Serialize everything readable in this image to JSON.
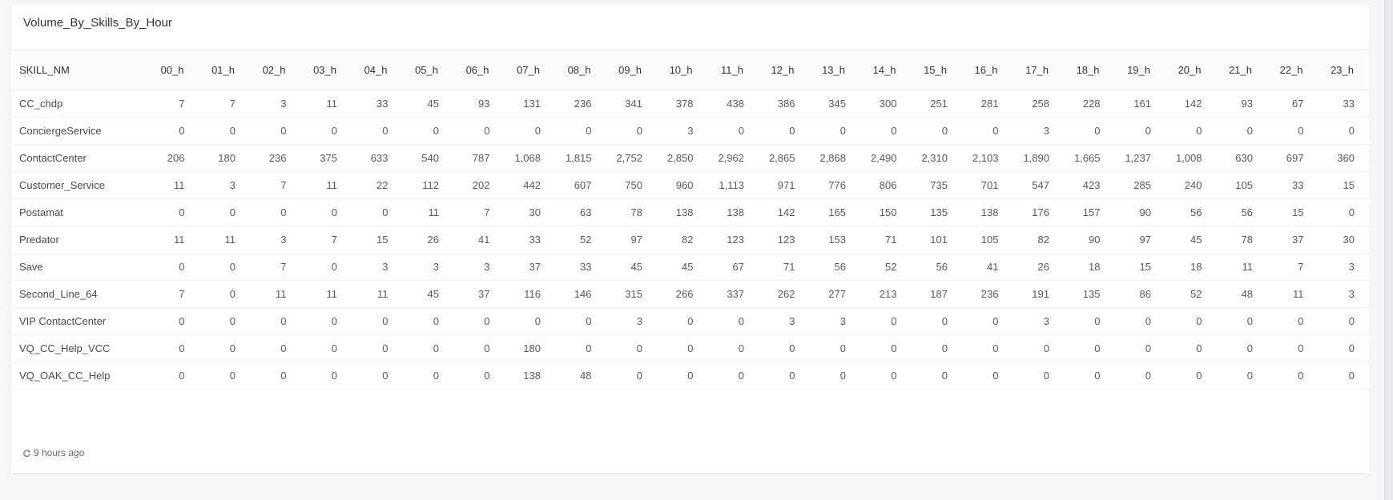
{
  "widget": {
    "title": "Volume_By_Skills_By_Hour",
    "refreshed": "9 hours ago"
  },
  "table": {
    "columns": [
      "SKILL_NM",
      "00_h",
      "01_h",
      "02_h",
      "03_h",
      "04_h",
      "05_h",
      "06_h",
      "07_h",
      "08_h",
      "09_h",
      "10_h",
      "11_h",
      "12_h",
      "13_h",
      "14_h",
      "15_h",
      "16_h",
      "17_h",
      "18_h",
      "19_h",
      "20_h",
      "21_h",
      "22_h",
      "23_h"
    ],
    "rows": [
      [
        "CC_chdp",
        "7",
        "7",
        "3",
        "11",
        "33",
        "45",
        "93",
        "131",
        "236",
        "341",
        "378",
        "438",
        "386",
        "345",
        "300",
        "251",
        "281",
        "258",
        "228",
        "161",
        "142",
        "93",
        "67",
        "33"
      ],
      [
        "ConciergeService",
        "0",
        "0",
        "0",
        "0",
        "0",
        "0",
        "0",
        "0",
        "0",
        "0",
        "3",
        "0",
        "0",
        "0",
        "0",
        "0",
        "0",
        "3",
        "0",
        "0",
        "0",
        "0",
        "0",
        "0"
      ],
      [
        "ContactCenter",
        "206",
        "180",
        "236",
        "375",
        "633",
        "540",
        "787",
        "1,068",
        "1,815",
        "2,752",
        "2,850",
        "2,962",
        "2,865",
        "2,868",
        "2,490",
        "2,310",
        "2,103",
        "1,890",
        "1,665",
        "1,237",
        "1,008",
        "630",
        "697",
        "360"
      ],
      [
        "Customer_Service",
        "11",
        "3",
        "7",
        "11",
        "22",
        "112",
        "202",
        "442",
        "607",
        "750",
        "960",
        "1,113",
        "971",
        "776",
        "806",
        "735",
        "701",
        "547",
        "423",
        "285",
        "240",
        "105",
        "33",
        "15"
      ],
      [
        "Postamat",
        "0",
        "0",
        "0",
        "0",
        "0",
        "11",
        "7",
        "30",
        "63",
        "78",
        "138",
        "138",
        "142",
        "165",
        "150",
        "135",
        "138",
        "176",
        "157",
        "90",
        "56",
        "56",
        "15",
        "0"
      ],
      [
        "Predator",
        "11",
        "11",
        "3",
        "7",
        "15",
        "26",
        "41",
        "33",
        "52",
        "97",
        "82",
        "123",
        "123",
        "153",
        "71",
        "101",
        "105",
        "82",
        "90",
        "97",
        "45",
        "78",
        "37",
        "30"
      ],
      [
        "Save",
        "0",
        "0",
        "7",
        "0",
        "3",
        "3",
        "3",
        "37",
        "33",
        "45",
        "45",
        "67",
        "71",
        "56",
        "52",
        "56",
        "41",
        "26",
        "18",
        "15",
        "18",
        "11",
        "7",
        "3"
      ],
      [
        "Second_Line_64",
        "7",
        "0",
        "11",
        "11",
        "11",
        "45",
        "37",
        "116",
        "146",
        "315",
        "266",
        "337",
        "262",
        "277",
        "213",
        "187",
        "236",
        "191",
        "135",
        "86",
        "52",
        "48",
        "11",
        "3"
      ],
      [
        "VIP ContactCenter",
        "0",
        "0",
        "0",
        "0",
        "0",
        "0",
        "0",
        "0",
        "0",
        "3",
        "0",
        "0",
        "3",
        "3",
        "0",
        "0",
        "0",
        "3",
        "0",
        "0",
        "0",
        "0",
        "0",
        "0"
      ],
      [
        "VQ_CC_Help_VCC",
        "0",
        "0",
        "0",
        "0",
        "0",
        "0",
        "0",
        "180",
        "0",
        "0",
        "0",
        "0",
        "0",
        "0",
        "0",
        "0",
        "0",
        "0",
        "0",
        "0",
        "0",
        "0",
        "0",
        "0"
      ],
      [
        "VQ_OAK_CC_Help",
        "0",
        "0",
        "0",
        "0",
        "0",
        "0",
        "0",
        "138",
        "48",
        "0",
        "0",
        "0",
        "0",
        "0",
        "0",
        "0",
        "0",
        "0",
        "0",
        "0",
        "0",
        "0",
        "0",
        "0"
      ]
    ]
  }
}
